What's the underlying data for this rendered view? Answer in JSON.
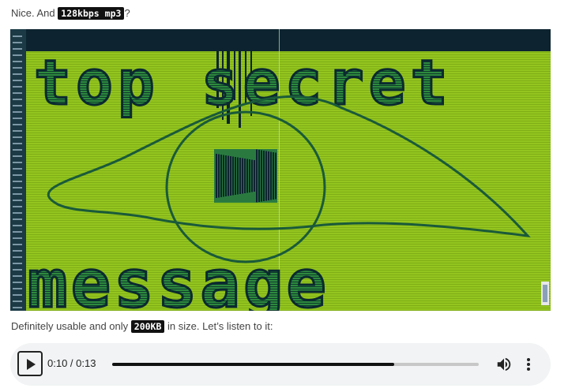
{
  "intro": {
    "prefix": "Nice. And ",
    "code": "128kbps mp3",
    "suffix": "?"
  },
  "spectrogram": {
    "text_top": "top secret",
    "text_bottom": "message",
    "colors": {
      "background": "#8fc11c",
      "dark": "#0d2a38",
      "glyph_fill": "#1f6f3a"
    }
  },
  "note": {
    "prefix": "Definitely usable and only ",
    "code": "200KB",
    "suffix": " in size. Let’s listen to it:"
  },
  "player": {
    "time_display": "0:10 / 0:13",
    "progress": 0.769,
    "icons": {
      "play": "play-icon",
      "volume": "volume-icon",
      "menu": "more-vert-icon"
    }
  }
}
